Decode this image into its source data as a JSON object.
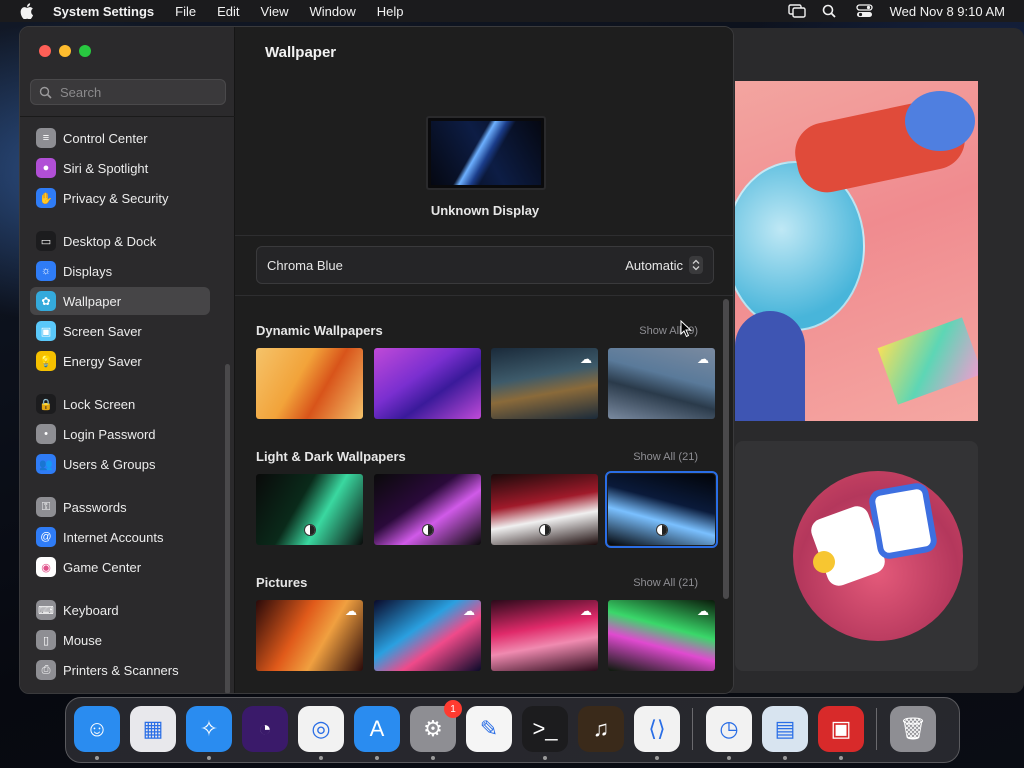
{
  "menubar": {
    "app_name": "System Settings",
    "items": [
      "File",
      "Edit",
      "View",
      "Window",
      "Help"
    ],
    "clock": "Wed Nov 8  9:10 AM"
  },
  "search": {
    "placeholder": "Search"
  },
  "sidebar": {
    "items": [
      {
        "label": "Control Center",
        "icon": "control-center-icon",
        "color": "#8e8e93"
      },
      {
        "label": "Siri & Spotlight",
        "icon": "siri-icon",
        "color": "#b14fd6"
      },
      {
        "label": "Privacy & Security",
        "icon": "hand-icon",
        "color": "#2f7cf6"
      },
      {
        "label": "Desktop & Dock",
        "icon": "desktop-dock-icon",
        "color": "#1c1c1e"
      },
      {
        "label": "Displays",
        "icon": "displays-icon",
        "color": "#2f7cf6"
      },
      {
        "label": "Wallpaper",
        "icon": "wallpaper-icon",
        "color": "#34aadc"
      },
      {
        "label": "Screen Saver",
        "icon": "screen-saver-icon",
        "color": "#5ac8fa"
      },
      {
        "label": "Energy Saver",
        "icon": "energy-saver-icon",
        "color": "#f5c000"
      },
      {
        "label": "Lock Screen",
        "icon": "lock-icon",
        "color": "#1c1c1e"
      },
      {
        "label": "Login Password",
        "icon": "login-password-icon",
        "color": "#8e8e93"
      },
      {
        "label": "Users & Groups",
        "icon": "users-icon",
        "color": "#2f7cf6"
      },
      {
        "label": "Passwords",
        "icon": "key-icon",
        "color": "#8e8e93"
      },
      {
        "label": "Internet Accounts",
        "icon": "at-icon",
        "color": "#2f7cf6"
      },
      {
        "label": "Game Center",
        "icon": "game-center-icon",
        "color": "#ffffff"
      },
      {
        "label": "Keyboard",
        "icon": "keyboard-icon",
        "color": "#8e8e93"
      },
      {
        "label": "Mouse",
        "icon": "mouse-icon",
        "color": "#8e8e93"
      },
      {
        "label": "Printers & Scanners",
        "icon": "printer-icon",
        "color": "#8e8e93"
      }
    ],
    "selected": "Wallpaper"
  },
  "main": {
    "title": "Wallpaper",
    "display_label": "Unknown Display",
    "wallpaper_name": "Chroma Blue",
    "mode": "Automatic",
    "sections": [
      {
        "title": "Dynamic Wallpapers",
        "show_all": "Show All (9)",
        "thumbs": [
          {
            "name": "ventura-orange",
            "colors": [
              "#f2a33a",
              "#d8541a",
              "#f5c36a"
            ],
            "cloud": false
          },
          {
            "name": "monterey-purple",
            "colors": [
              "#7a2fd0",
              "#3a1a9a",
              "#c04ad8"
            ],
            "cloud": false
          },
          {
            "name": "catalina-coast",
            "colors": [
              "#3d5a6a",
              "#8a6a3a",
              "#1a2a3a"
            ],
            "cloud": true
          },
          {
            "name": "catalina-island",
            "colors": [
              "#5a7a9a",
              "#2a3a4a",
              "#7a8aa0"
            ],
            "cloud": true
          }
        ]
      },
      {
        "title": "Light & Dark Wallpapers",
        "show_all": "Show All (21)",
        "thumbs": [
          {
            "name": "green-lines",
            "colors": [
              "#0a2a1a",
              "#3ad8a0",
              "#0a0a0a"
            ],
            "badge": true
          },
          {
            "name": "purple-lines",
            "colors": [
              "#2a0a3a",
              "#d05ae8",
              "#0a0a0a"
            ],
            "badge": true
          },
          {
            "name": "red-swoosh",
            "colors": [
              "#a01a2a",
              "#f0f0f0",
              "#1a0a0a"
            ],
            "badge": true
          },
          {
            "name": "chroma-blue",
            "colors": [
              "#0a1a3a",
              "#7ac0ff",
              "#020408"
            ],
            "badge": true,
            "selected": true
          }
        ]
      },
      {
        "title": "Pictures",
        "show_all": "Show All (21)",
        "thumbs": [
          {
            "name": "orange-flow",
            "colors": [
              "#e05a1a",
              "#f0a040",
              "#2a0a0a"
            ],
            "cloud": true
          },
          {
            "name": "rainbow-flow",
            "colors": [
              "#2aa0e0",
              "#f04a8a",
              "#0a0a2a"
            ],
            "cloud": true
          },
          {
            "name": "pink-flow",
            "colors": [
              "#e02a6a",
              "#f08ab0",
              "#2a0a1a"
            ],
            "cloud": true
          },
          {
            "name": "green-flow",
            "colors": [
              "#3ad86a",
              "#e04ad0",
              "#0a1a0a"
            ],
            "cloud": true
          }
        ]
      }
    ]
  },
  "dock": {
    "apps": [
      {
        "name": "finder-icon",
        "bg": "#2a8cf0"
      },
      {
        "name": "launchpad-icon",
        "bg": "#e8e8ec"
      },
      {
        "name": "safari-icon",
        "bg": "#2a8cf0"
      },
      {
        "name": "firefox-icon",
        "bg": "#3a1a6a"
      },
      {
        "name": "chrome-icon",
        "bg": "#f2f2f2"
      },
      {
        "name": "app-store-icon",
        "bg": "#2a8cf0"
      },
      {
        "name": "system-settings-icon",
        "bg": "#8e8e93",
        "badge": "1"
      },
      {
        "name": "textedit-icon",
        "bg": "#f5f5f5"
      },
      {
        "name": "terminal-icon",
        "bg": "#1c1c1e"
      },
      {
        "name": "garageband-icon",
        "bg": "#3a2a1a"
      },
      {
        "name": "vscode-icon",
        "bg": "#f2f2f2"
      }
    ],
    "recent": [
      {
        "name": "clock-icon",
        "bg": "#f2f2f2"
      },
      {
        "name": "preview-icon",
        "bg": "#d8e4f0"
      },
      {
        "name": "photo-booth-icon",
        "bg": "#d82a2a"
      }
    ],
    "trash": {
      "name": "trash-icon",
      "bg": "#8e8e93"
    }
  }
}
